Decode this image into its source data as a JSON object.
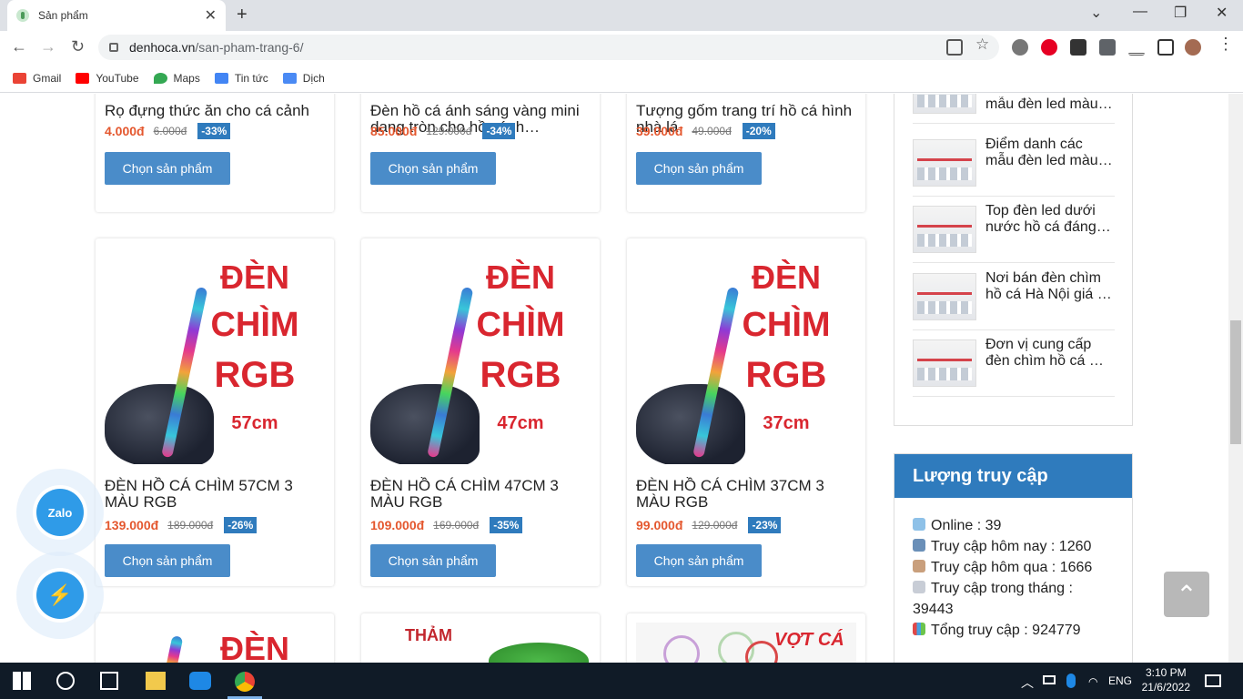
{
  "browser": {
    "tab_title": "Sản phẩm",
    "url_host": "denhoca.vn",
    "url_path": "/san-pham-trang-6/",
    "bookmarks": [
      "Gmail",
      "YouTube",
      "Maps",
      "Tin tức",
      "Dịch"
    ]
  },
  "products_row1": [
    {
      "name": "Rọ đựng thức ăn cho cá cảnh",
      "price": "4.000đ",
      "old_price": "6.000đ",
      "discount": "-33%",
      "button": "Chọn sản phẩm"
    },
    {
      "name": "Đèn hồ cá ánh sáng vàng mini dạng tròn cho hồ cá, h…",
      "price": "85.000đ",
      "old_price": "129.000đ",
      "discount": "-34%",
      "button": "Chọn sản phẩm"
    },
    {
      "name": "Tượng gốm trang trí hồ cá hình nhà lá",
      "price": "39.000đ",
      "old_price": "49.000đ",
      "discount": "-20%",
      "button": "Chọn sản phẩm"
    }
  ],
  "products_row2": [
    {
      "name": "ĐÈN HỒ CÁ CHÌM 57CM 3 MÀU RGB",
      "price": "139.000đ",
      "old_price": "189.000đ",
      "discount": "-26%",
      "button": "Chọn sản phẩm",
      "img_l1": "ĐÈN",
      "img_l2": "CHÌM",
      "img_l3": "RGB",
      "img_size": "57cm"
    },
    {
      "name": "ĐÈN HỒ CÁ CHÌM 47CM 3 MÀU RGB",
      "price": "109.000đ",
      "old_price": "169.000đ",
      "discount": "-35%",
      "button": "Chọn sản phẩm",
      "img_l1": "ĐÈN",
      "img_l2": "CHÌM",
      "img_l3": "RGB",
      "img_size": "47cm"
    },
    {
      "name": "ĐÈN HỒ CÁ CHÌM 37CM 3 MÀU RGB",
      "price": "99.000đ",
      "old_price": "129.000đ",
      "discount": "-23%",
      "button": "Chọn sản phẩm",
      "img_l1": "ĐÈN",
      "img_l2": "CHÌM",
      "img_l3": "RGB",
      "img_size": "37cm"
    }
  ],
  "products_row3": [
    {
      "img_text": "ĐÈN"
    },
    {
      "img_text": "THẢM"
    },
    {
      "img_text": "VỢT CÁ"
    }
  ],
  "sidebar_posts": [
    "mẫu đèn led màu…",
    "Điểm danh các mẫu đèn led màu…",
    "Top đèn led dưới nước hồ cá đáng…",
    "Nơi bán đèn chìm hồ cá Hà Nội giá …",
    "Đơn vị cung cấp đèn chìm hồ cá …"
  ],
  "visits": {
    "title": "Lượng truy cập",
    "online": "Online : 39",
    "today": "Truy cập hôm nay : 1260",
    "yesterday": "Truy cập hôm qua : 1666",
    "month": "Truy cập trong tháng :",
    "month_value": "39443",
    "total": "Tổng truy cập : 924779"
  },
  "floating": {
    "zalo": "Zalo"
  },
  "taskbar": {
    "lang": "ENG",
    "time": "3:10 PM",
    "date": "21/6/2022"
  }
}
